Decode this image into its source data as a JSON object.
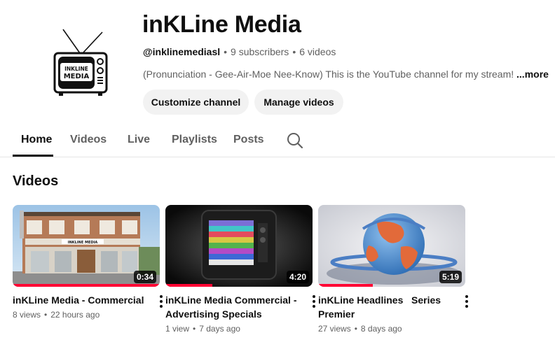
{
  "channel": {
    "name": "inKLine Media",
    "handle": "@inklinemediasl",
    "subscribers": "9 subscribers",
    "videos_count": "6 videos",
    "separator": "•",
    "description": "(Pronunciation - Gee-Air-Moe Nee-Know) This is the YouTube channel for my stream!",
    "more_label": "...more",
    "avatar_text": [
      "INKLINE",
      "MEDIA"
    ]
  },
  "buttons": {
    "customize": "Customize channel",
    "manage": "Manage videos"
  },
  "tabs": [
    {
      "label": "Home",
      "active": true
    },
    {
      "label": "Videos",
      "active": false
    },
    {
      "label": "Live",
      "active": false
    },
    {
      "label": "Playlists",
      "active": false
    },
    {
      "label": "Posts",
      "active": false
    }
  ],
  "search_icon": "search-icon",
  "section": {
    "title": "Videos"
  },
  "videos": [
    {
      "title": "inKLine Media - Commercial",
      "duration": "0:34",
      "views": "8 views",
      "age": "22 hours ago",
      "progress": 1.0,
      "sign_text": "INKLINE MEDIA"
    },
    {
      "title": "inKLine Media Commercial - Advertising Specials",
      "duration": "4:20",
      "views": "1 view",
      "age": "7 days ago",
      "progress": 0.32
    },
    {
      "title": "inKLine Headlines   Series Premier",
      "duration": "5:19",
      "views": "27 views",
      "age": "8 days ago",
      "progress": 0.37
    }
  ],
  "colors": {
    "accent": "#ff0033",
    "text": "#0f0f0f",
    "secondary": "#606060",
    "button_bg": "#f2f2f2"
  }
}
